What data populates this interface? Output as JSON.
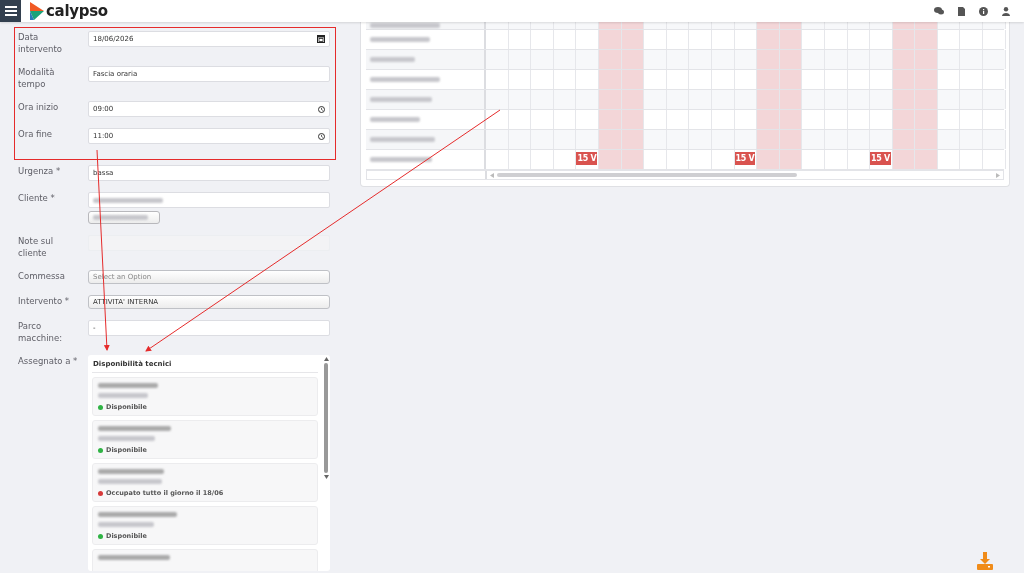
{
  "header": {
    "logo": "calypso"
  },
  "form": {
    "highlighted_fields": [
      {
        "label": "Data intervento",
        "kind": "date",
        "value": "18/06/2026"
      },
      {
        "label": "Modalità tempo",
        "kind": "text",
        "value": "Fascia oraria"
      },
      {
        "label": "Ora inizio",
        "kind": "time",
        "value": "09:00"
      },
      {
        "label": "Ora fine",
        "kind": "time",
        "value": "11:00"
      }
    ],
    "fields": [
      {
        "label": "Urgenza *",
        "kind": "text",
        "value": "bassa"
      },
      {
        "label": "Cliente *",
        "kind": "client"
      },
      {
        "label": "Note sul cliente",
        "kind": "disabled"
      },
      {
        "label": "Commessa",
        "kind": "select",
        "placeholder": "Select an Option"
      },
      {
        "label": "Intervento *",
        "kind": "select",
        "value": "ATTIVITA' INTERNA"
      },
      {
        "label": "Parco macchine:",
        "kind": "text",
        "value": "-"
      },
      {
        "label": "Assegnato a *",
        "kind": "availability"
      }
    ]
  },
  "availability": {
    "title": "Disponibilità tecnici",
    "technicians": [
      {
        "status": "Disponibile",
        "color": "#2fb344",
        "partial": false
      },
      {
        "status": "Disponibile",
        "color": "#2fb344",
        "partial": false
      },
      {
        "status": "Occupato tutto il giorno il 18/06",
        "color": "#d63939",
        "partial": false
      },
      {
        "status": "Disponibile",
        "color": "#2fb344",
        "partial": false
      },
      {
        "partial": true
      }
    ]
  },
  "gantt": {
    "columns": [
      {
        "weekend": false
      },
      {
        "weekend": false
      },
      {
        "weekend": false
      },
      {
        "weekend": false
      },
      {
        "weekend": false,
        "badge": "15 V"
      },
      {
        "weekend": true
      },
      {
        "weekend": true
      },
      {
        "weekend": false
      },
      {
        "weekend": false
      },
      {
        "weekend": false
      },
      {
        "weekend": false
      },
      {
        "weekend": false,
        "badge": "15 V"
      },
      {
        "weekend": true
      },
      {
        "weekend": true
      },
      {
        "weekend": false
      },
      {
        "weekend": false
      },
      {
        "weekend": false
      },
      {
        "weekend": false,
        "badge": "15 V"
      },
      {
        "weekend": true
      },
      {
        "weekend": true
      },
      {
        "weekend": false
      },
      {
        "weekend": false
      },
      {
        "weekend": false
      }
    ],
    "rows": [
      {
        "partial": true
      },
      {
        "partial": false
      },
      {
        "partial": false
      },
      {
        "partial": false
      },
      {
        "partial": false
      },
      {
        "partial": false
      },
      {
        "partial": false
      },
      {
        "partial": false
      }
    ]
  }
}
